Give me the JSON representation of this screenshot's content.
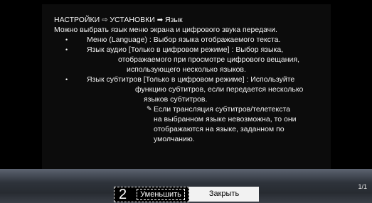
{
  "header": {
    "crumb1": "НАСТРОЙКИ",
    "arrow1": "⇨",
    "crumb2": "УСТАНОВКИ",
    "arrow2": "➡",
    "crumb3": "Язык"
  },
  "intro": "Можно выбрать язык меню экрана и цифрового звука передачи.",
  "items": [
    {
      "lines": [
        "Меню (Language) : Выбор языка отображаемого текста."
      ]
    },
    {
      "lines": [
        "Язык аудио [Только в цифровом режиме] : Выбор языка,",
        "отображаемого при просмотре цифрового вещания,",
        "использующего несколько языков."
      ]
    },
    {
      "lines": [
        "Язык субтитров [Только в цифровом режиме] : Используйте",
        "функцию субтитров, если передается несколько",
        "языков субтитров."
      ]
    }
  ],
  "note": {
    "icon": "✎",
    "lines": [
      "Если трансляция субтитров/телетекста",
      "на выбранном языке невозможна, то они",
      "отображаются на языке, заданном по",
      "умолчанию."
    ]
  },
  "footer": {
    "page": "1/1",
    "step_number": "2",
    "reduce_label": "Уменьшить",
    "close_label": "Закрыть"
  }
}
